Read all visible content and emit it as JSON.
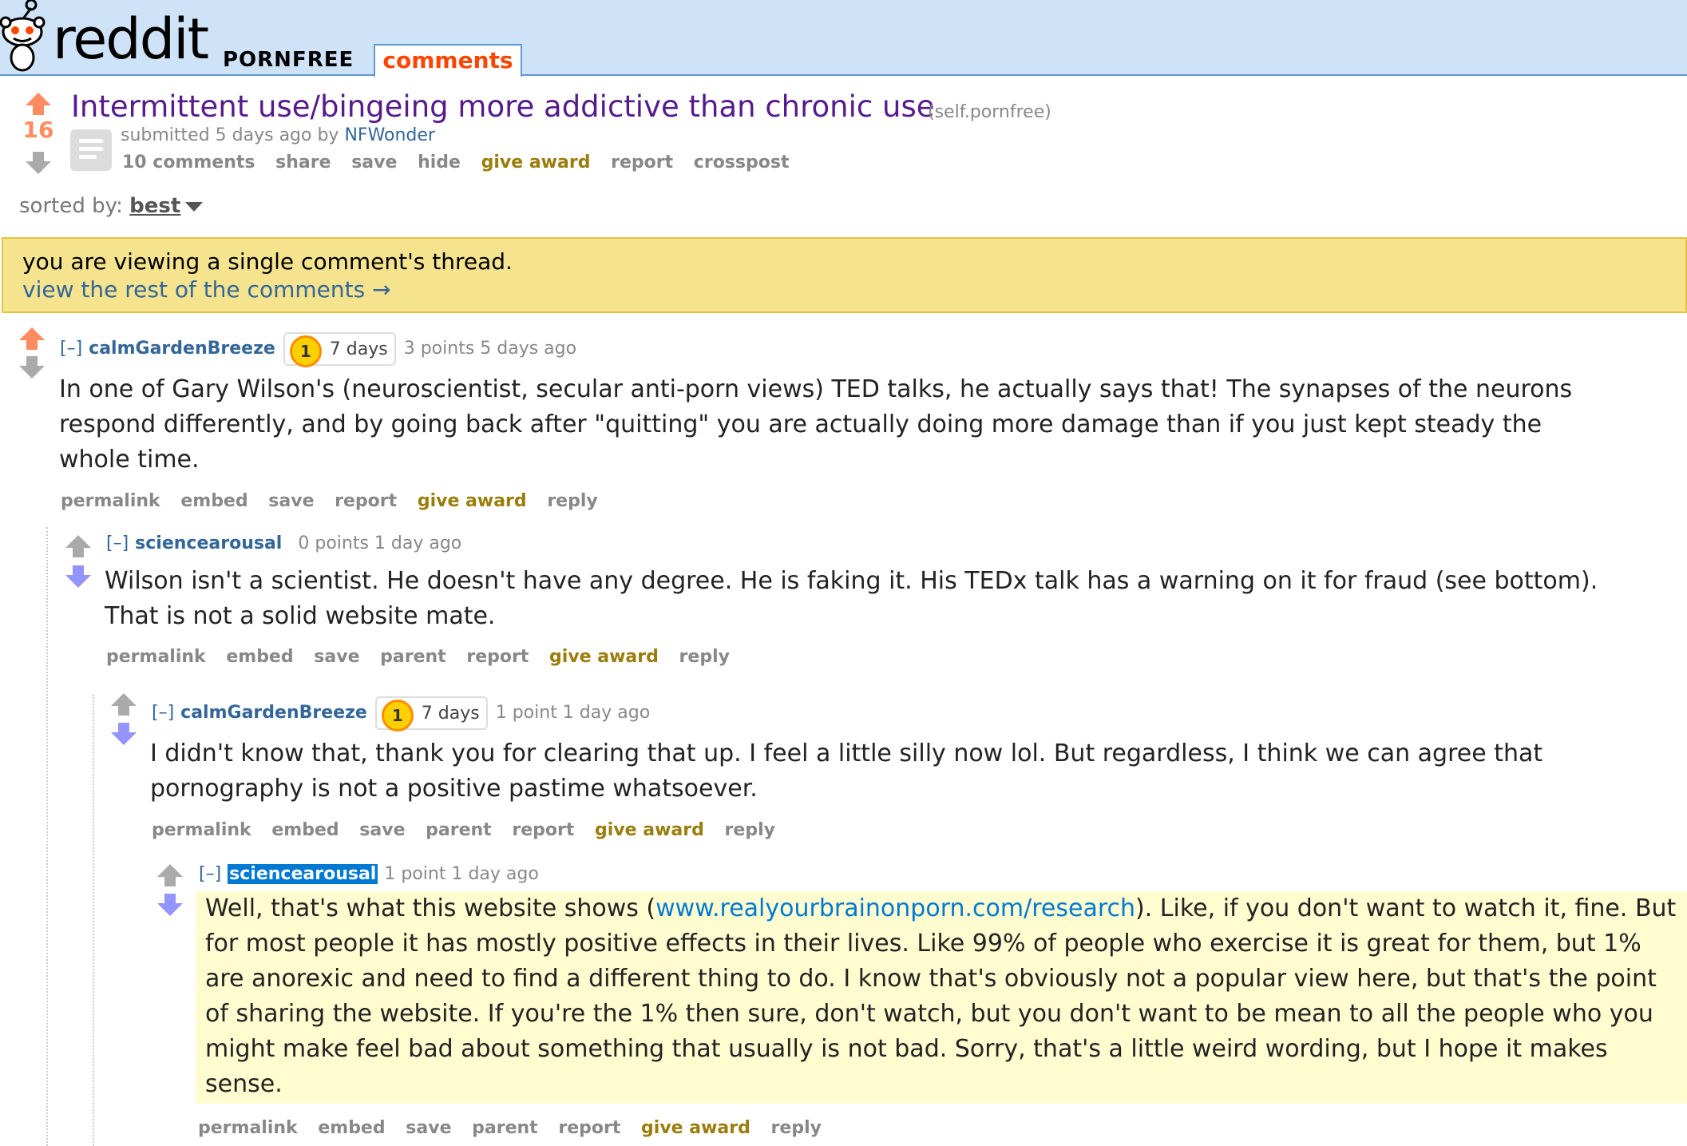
{
  "header": {
    "logo_text": "reddit",
    "subreddit": "PORNFREE",
    "active_tab": "comments"
  },
  "post": {
    "score": "16",
    "title": "Intermittent use/bingeing more addictive than chronic use",
    "domain": "(self.pornfree)",
    "tagline_prefix": "submitted 5 days ago by ",
    "author": "NFWonder",
    "buttons": [
      "10 comments",
      "share",
      "save",
      "hide",
      "give award",
      "report",
      "crosspost"
    ]
  },
  "sort": {
    "label": "sorted by: ",
    "value": "best"
  },
  "banner": {
    "text": "you are viewing a single comment's thread.",
    "link": "view the rest of the comments →"
  },
  "comments": [
    {
      "expand": "[–]",
      "author": "calmGardenBreeze",
      "flair_badge": "1",
      "flair_text": "7 days",
      "meta": "3 points 5 days ago",
      "body": "In one of Gary Wilson's (neuroscientist, secular anti-porn views) TED talks, he actually says that! The synapses of the neurons respond differently, and by going back after \"quitting\" you are actually doing more damage than if you just kept steady the whole time.",
      "buttons": [
        "permalink",
        "embed",
        "save",
        "report",
        "give award",
        "reply"
      ]
    },
    {
      "expand": "[–]",
      "author": "sciencearousal",
      "meta": "0 points 1 day ago",
      "body": "Wilson isn't a scientist. He doesn't have any degree. He is faking it. His TEDx talk has a warning on it for fraud (see bottom). That is not a solid website mate.",
      "buttons": [
        "permalink",
        "embed",
        "save",
        "parent",
        "report",
        "give award",
        "reply"
      ]
    },
    {
      "expand": "[–]",
      "author": "calmGardenBreeze",
      "flair_badge": "1",
      "flair_text": "7 days",
      "meta": "1 point 1 day ago",
      "body": "I didn't know that, thank you for clearing that up. I feel a little silly now lol. But regardless, I think we can agree that pornography is not a positive pastime whatsoever.",
      "buttons": [
        "permalink",
        "embed",
        "save",
        "parent",
        "report",
        "give award",
        "reply"
      ]
    },
    {
      "expand": "[–]",
      "author": "sciencearousal",
      "meta": "1 point 1 day ago",
      "body_before": "Well, that's what this website shows (",
      "body_link": "www.realyourbrainonporn.com/research",
      "body_after": "). Like, if you don't want to watch it, fine. But for most people it has mostly positive effects in their lives. Like 99% of people who exercise it is great for them, but 1% are anorexic and need to find a different thing to do. I know that's obviously not a popular view here, but that's the point of sharing the website. If you're the 1% then sure, don't watch, but you don't want to be mean to all the people who you might make feel bad about something that usually is not bad. Sorry, that's a little weird wording, but I hope it makes sense.",
      "buttons": [
        "permalink",
        "embed",
        "save",
        "parent",
        "report",
        "give award",
        "reply"
      ]
    }
  ]
}
